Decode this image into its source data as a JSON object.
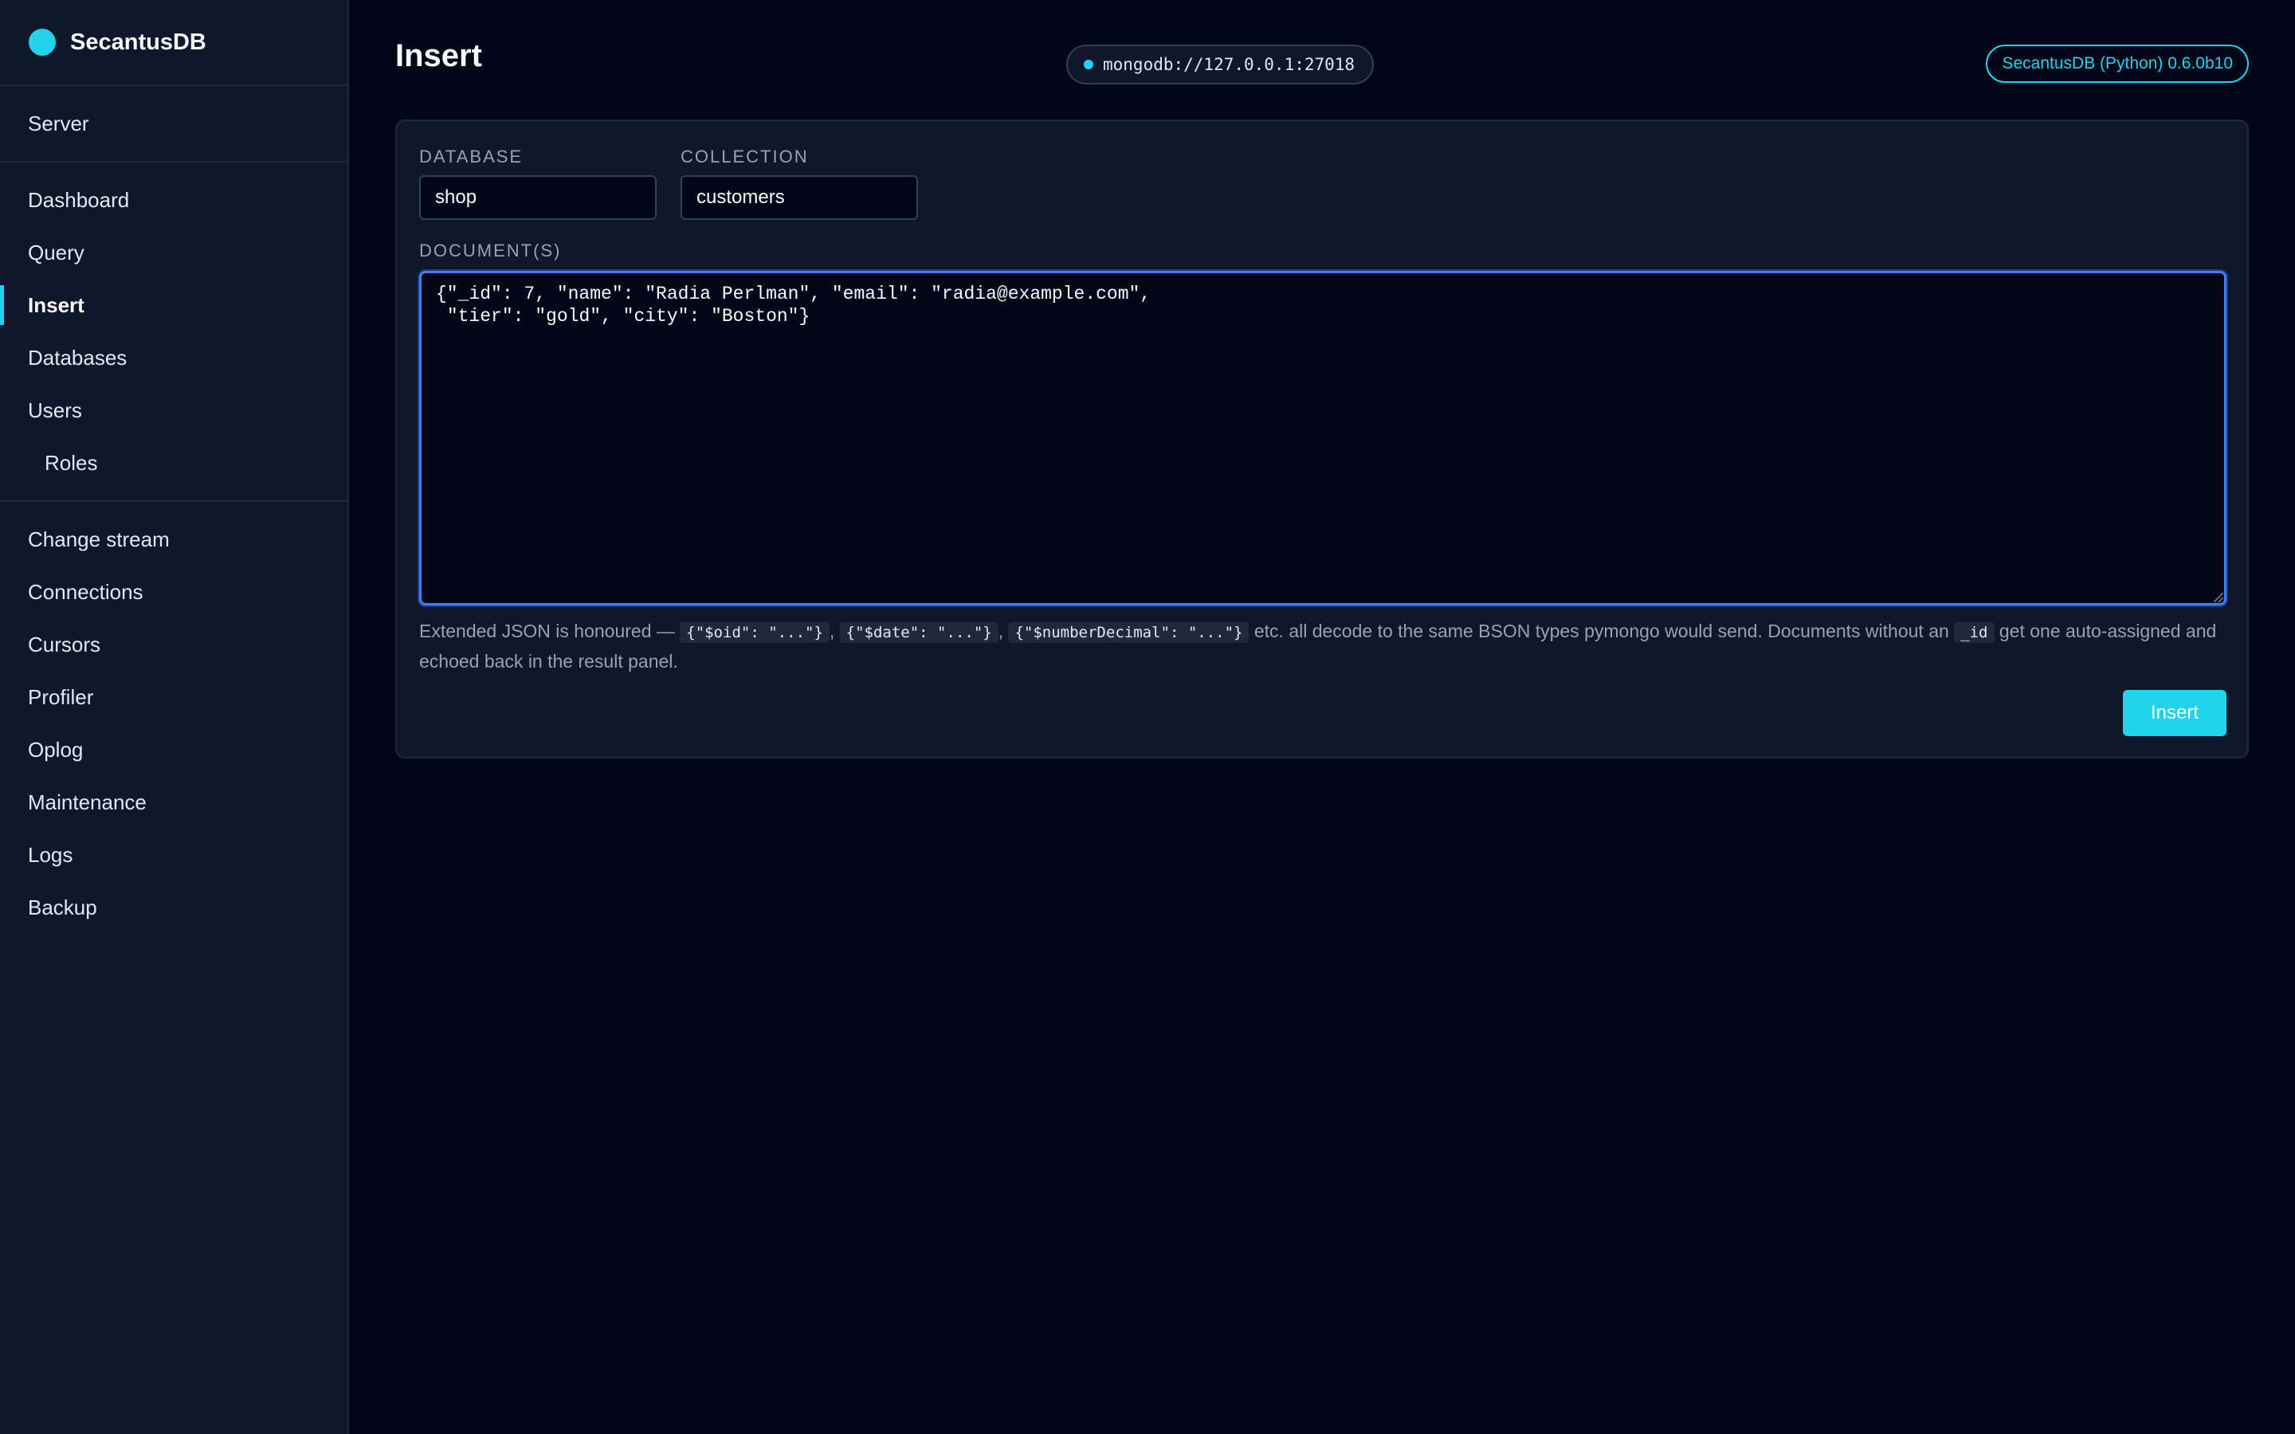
{
  "brand": {
    "name": "SecantusDB",
    "accent": "#22d3ee"
  },
  "sidebar": {
    "sections": [
      [
        {
          "label": "Server"
        }
      ],
      [
        {
          "label": "Dashboard"
        },
        {
          "label": "Query"
        },
        {
          "label": "Insert",
          "active": true
        },
        {
          "label": "Databases"
        },
        {
          "label": "Users"
        },
        {
          "label": "Roles",
          "sub": true
        }
      ],
      [
        {
          "label": "Change stream"
        },
        {
          "label": "Connections"
        },
        {
          "label": "Cursors"
        },
        {
          "label": "Profiler"
        },
        {
          "label": "Oplog"
        },
        {
          "label": "Maintenance"
        },
        {
          "label": "Logs"
        },
        {
          "label": "Backup"
        }
      ]
    ]
  },
  "header": {
    "title": "Insert",
    "connection": "mongodb://127.0.0.1:27018",
    "version": "SecantusDB (Python) 0.6.0b10"
  },
  "form": {
    "database_label": "DATABASE",
    "database_value": "shop",
    "collection_label": "COLLECTION",
    "collection_value": "customers",
    "documents_label": "DOCUMENT(S)",
    "document_value": "{\"_id\": 7, \"name\": \"Radia Perlman\", \"email\": \"radia@example.com\",\n \"tier\": \"gold\", \"city\": \"Boston\"}",
    "help": {
      "prefix": "Extended JSON is honoured — ",
      "code_oid": "{\"$oid\": \"...\"}",
      "sep1": ", ",
      "code_date": "{\"$date\": \"...\"}",
      "sep2": ", ",
      "code_decimal": "{\"$numberDecimal\": \"...\"}",
      "middle": " etc. all decode to the same BSON types pymongo would send. Documents without an ",
      "code_id": "_id",
      "suffix": " get one auto-assigned and echoed back in the result panel."
    },
    "submit_label": "Insert"
  }
}
